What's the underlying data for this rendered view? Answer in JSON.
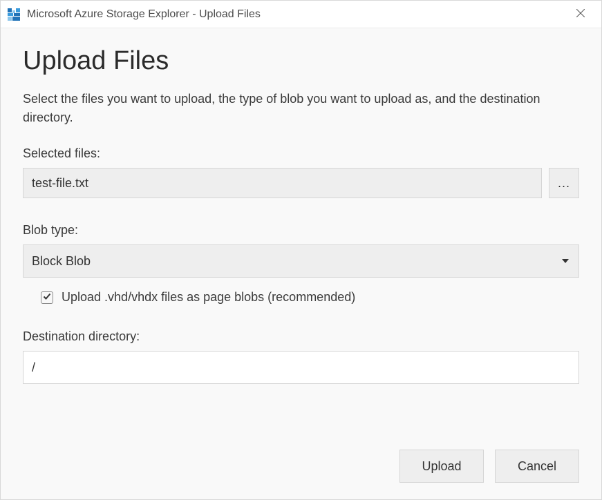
{
  "window_title": "Microsoft Azure Storage Explorer - Upload Files",
  "heading": "Upload Files",
  "description": "Select the files you want to upload, the type of blob you want to upload as, and the destination directory.",
  "selected_files": {
    "label": "Selected files:",
    "value": "test-file.txt",
    "browse_label": "..."
  },
  "blob_type": {
    "label": "Blob type:",
    "selected": "Block Blob",
    "vhd_checkbox_label": "Upload .vhd/vhdx files as page blobs (recommended)",
    "vhd_checked": true
  },
  "destination": {
    "label": "Destination directory:",
    "value": "/"
  },
  "buttons": {
    "upload": "Upload",
    "cancel": "Cancel"
  }
}
